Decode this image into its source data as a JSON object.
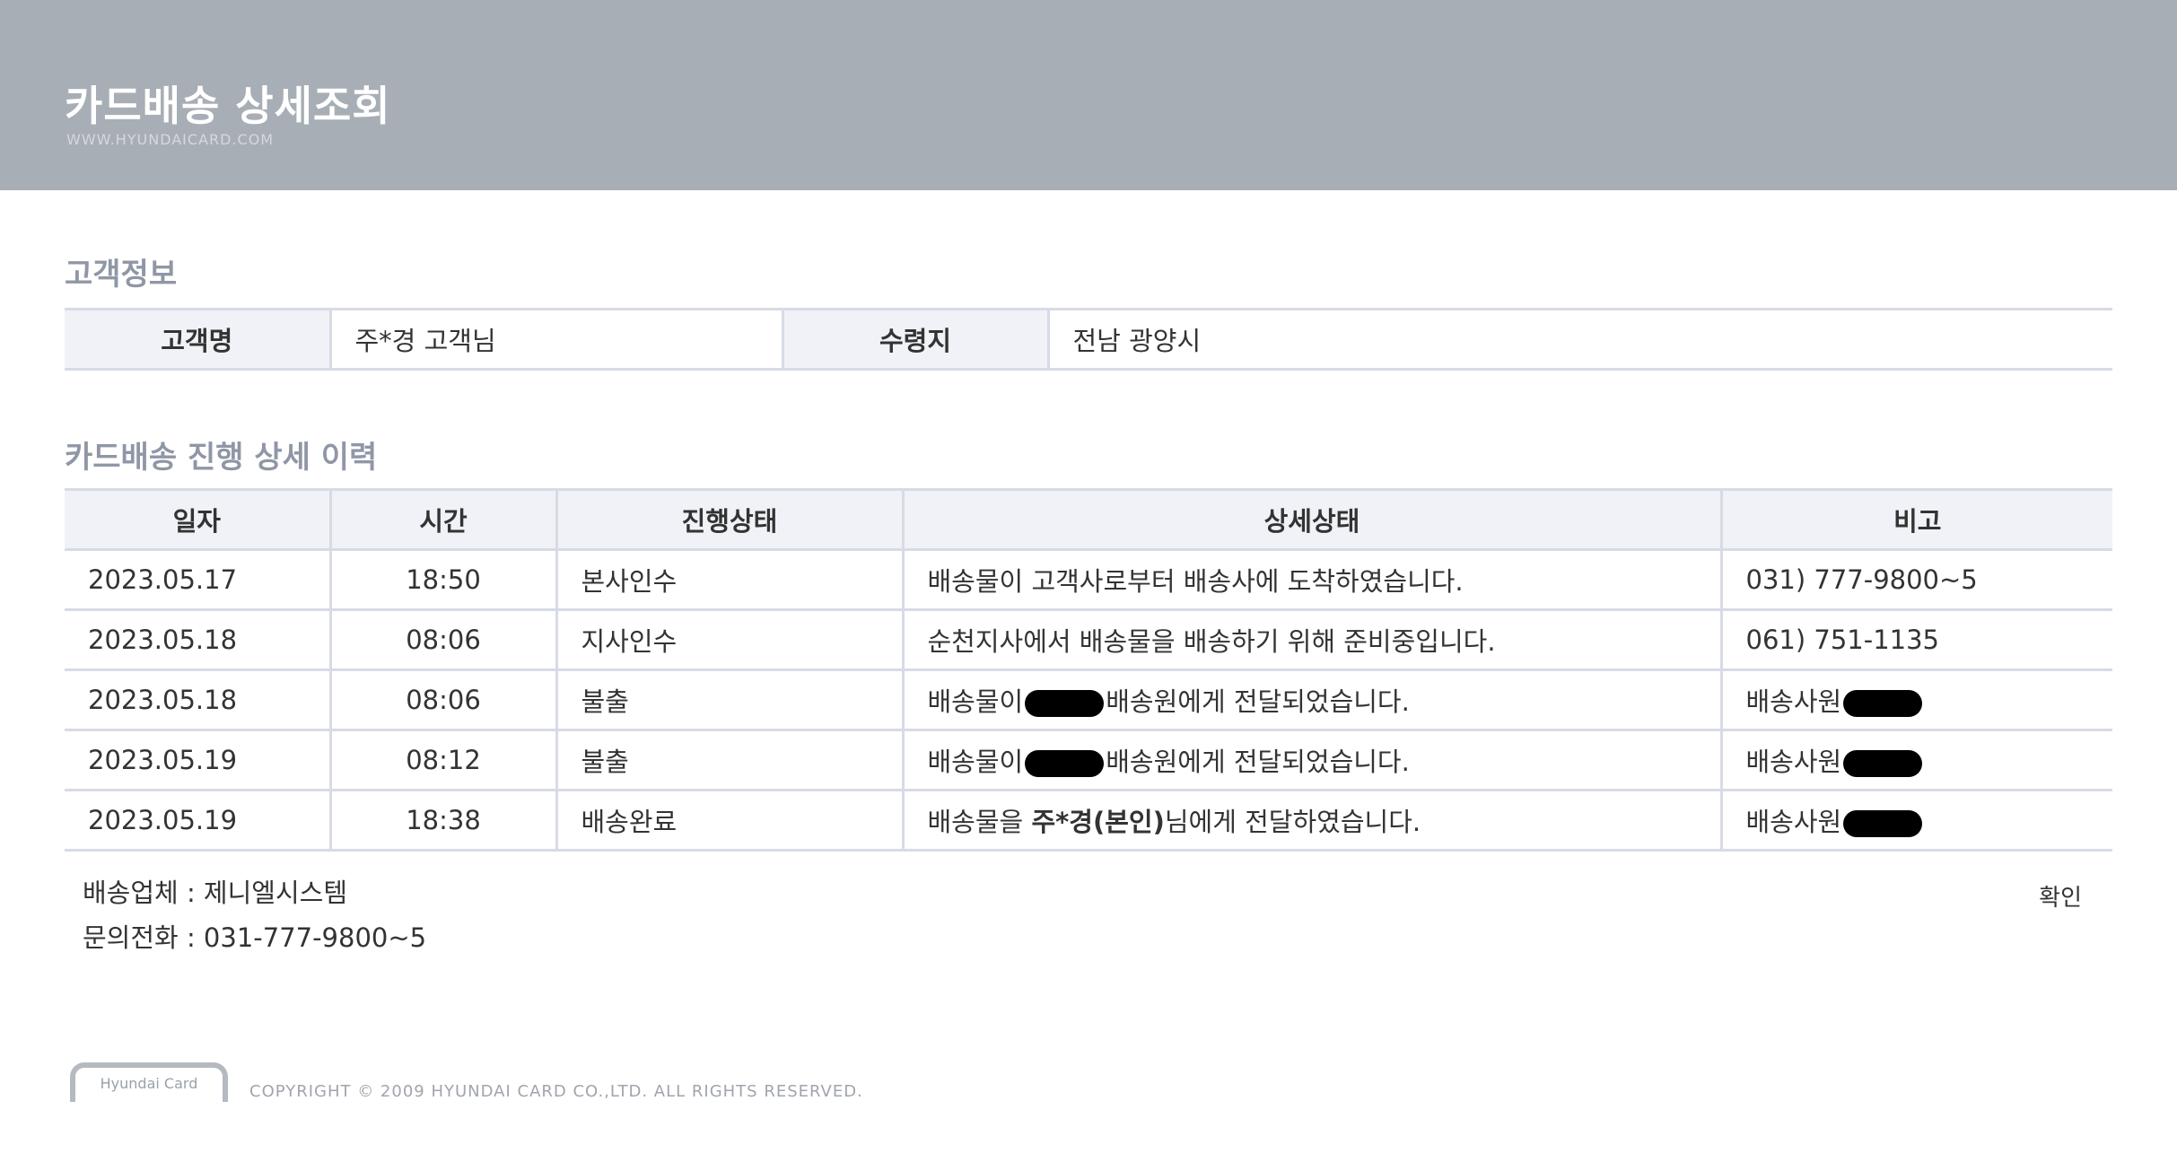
{
  "header": {
    "title": "카드배송 상세조회",
    "url": "WWW.HYUNDAICARD.COM"
  },
  "customer_section": {
    "title": "고객정보",
    "name_label": "고객명",
    "name_value": "주*경 고객님",
    "dest_label": "수령지",
    "dest_value": "전남 광양시"
  },
  "history_section": {
    "title": "카드배송 진행 상세 이력",
    "columns": [
      "일자",
      "시간",
      "진행상태",
      "상세상태",
      "비고"
    ],
    "rows": [
      {
        "date": "2023.05.17",
        "time": "18:50",
        "status": "본사인수",
        "detail": "배송물이 고객사로부터 배송사에 도착하였습니다.",
        "note": "031) 777-9800~5"
      },
      {
        "date": "2023.05.18",
        "time": "08:06",
        "status": "지사인수",
        "detail": "순천지사에서 배송물을 배송하기 위해 준비중입니다.",
        "note": "061) 751-1135"
      },
      {
        "date": "2023.05.18",
        "time": "08:06",
        "status": "불출",
        "detail_pre": "배송물이",
        "detail_post": "배송원에게 전달되었습니다.",
        "note": "배송사원"
      },
      {
        "date": "2023.05.19",
        "time": "08:12",
        "status": "불출",
        "detail_pre": "배송물이",
        "detail_post": "배송원에게 전달되었습니다.",
        "note": "배송사원"
      },
      {
        "date": "2023.05.19",
        "time": "18:38",
        "status": "배송완료",
        "detail_pre": "배송물을 ",
        "detail_strong": "주*경(본인)",
        "detail_post": "님에게 전달하였습니다.",
        "note": "배송사원"
      }
    ]
  },
  "courier": {
    "company": "배송업체 : 제니엘시스템",
    "phone": "문의전화 : 031-777-9800~5"
  },
  "confirm_label": "확인",
  "footer": {
    "logo_text": "Hyundai Card",
    "copyright": "COPYRIGHT © 2009 HYUNDAI CARD CO.,LTD.   ALL RIGHTS RESERVED."
  },
  "colors": {
    "header_bg": "#a8aeb5",
    "section_title": "#8f97a6",
    "table_border": "#d7dbe6",
    "table_head_bg": "#f0f2f7"
  }
}
